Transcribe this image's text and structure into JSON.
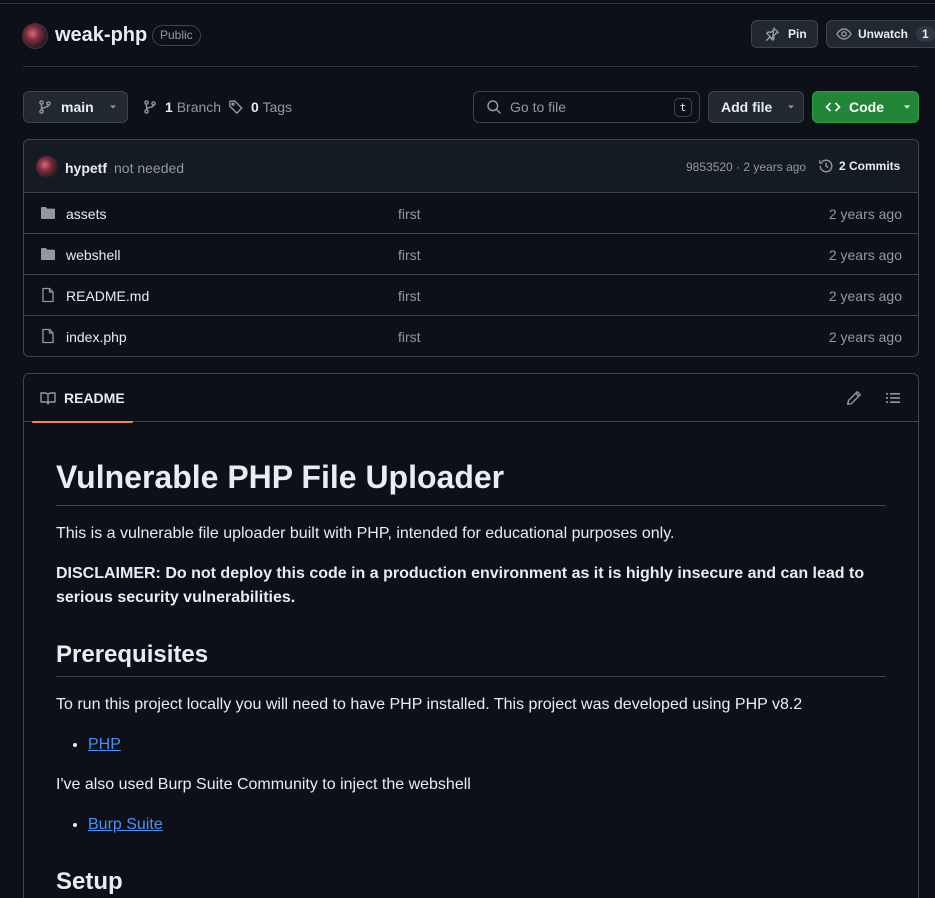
{
  "repo": {
    "name": "weak-php",
    "visibility": "Public",
    "pin_label": "Pin",
    "watch_label": "Unwatch",
    "watch_count": "1"
  },
  "nav": {
    "branch": "main",
    "branch_count": "1",
    "branch_label": "Branch",
    "tag_count": "0",
    "tag_label": "Tags",
    "goto_placeholder": "Go to file",
    "goto_shortcut": "t",
    "add_file": "Add file",
    "code": "Code"
  },
  "commit": {
    "author": "hypetf",
    "message": "not needed",
    "hash_age": "9853520 · 2 years ago",
    "commits_label": "2 Commits"
  },
  "files": [
    {
      "name": "assets",
      "type": "folder",
      "message": "first",
      "age": "2 years ago"
    },
    {
      "name": "webshell",
      "type": "folder",
      "message": "first",
      "age": "2 years ago"
    },
    {
      "name": "README.md",
      "type": "file",
      "message": "first",
      "age": "2 years ago"
    },
    {
      "name": "index.php",
      "type": "file",
      "message": "first",
      "age": "2 years ago"
    }
  ],
  "readme": {
    "tab_label": "README",
    "title": "Vulnerable PHP File Uploader",
    "intro": "This is a vulnerable file uploader built with PHP, intended for educational purposes only.",
    "disclaimer": "DISCLAIMER: Do not deploy this code in a production environment as it is highly insecure and can lead to serious security vulnerabilities.",
    "prereq_heading": "Prerequisites",
    "prereq_text": "To run this project locally you will need to have PHP installed. This project was developed using PHP v8.2",
    "link_php": "PHP",
    "burp_text": "I've also used Burp Suite Community to inject the webshell",
    "link_burp": "Burp Suite",
    "setup_heading": "Setup"
  },
  "colors": {
    "background": "#0d1117",
    "border": "#3d444d",
    "primary_button": "#238636",
    "link": "#4493f8",
    "tab_underline": "#f78166"
  }
}
